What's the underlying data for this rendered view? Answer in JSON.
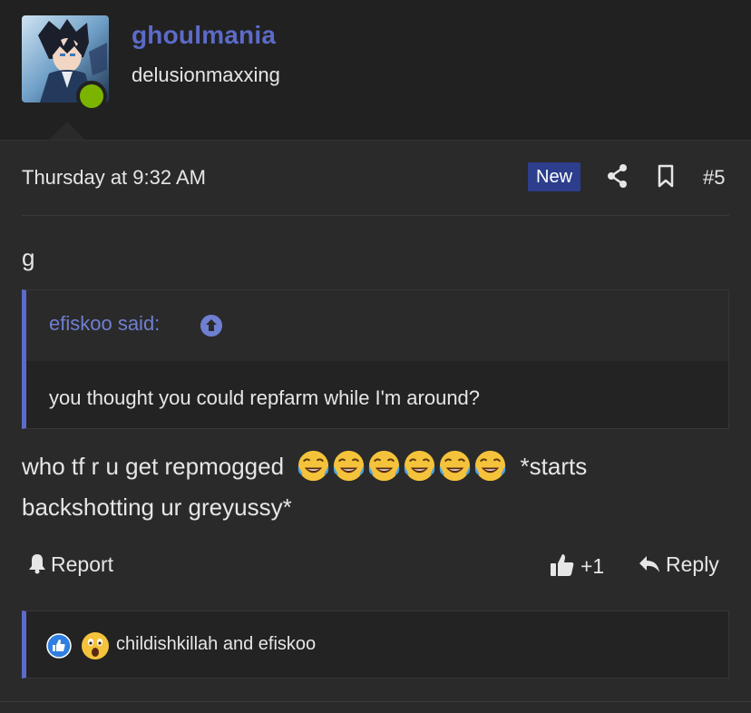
{
  "user": {
    "name": "ghoulmania",
    "title": "delusionmaxxing",
    "status_color": "#7bb300"
  },
  "post": {
    "date": "Thursday at 9:32 AM",
    "badge": "New",
    "number": "#5",
    "first_line": "g",
    "quote": {
      "author": "efiskoo said:",
      "text": "you thought you could repfarm while I'm around?"
    },
    "message_before": "who tf r u get repmogged",
    "emoji": "face-with-tears-of-joy",
    "emoji_count": 6,
    "message_after": "*starts backshotting ur greyussy*"
  },
  "actions": {
    "report": "Report",
    "like_count": "+1",
    "reply": "Reply"
  },
  "reactions": {
    "icons": [
      "like-icon",
      "wow-icon"
    ],
    "names": "childishkillah and efiskoo"
  },
  "colors": {
    "accent": "#5c6bc8",
    "background": "#212121",
    "post_bg": "#2a2a2a",
    "badge_bg": "#2c3e8c"
  }
}
